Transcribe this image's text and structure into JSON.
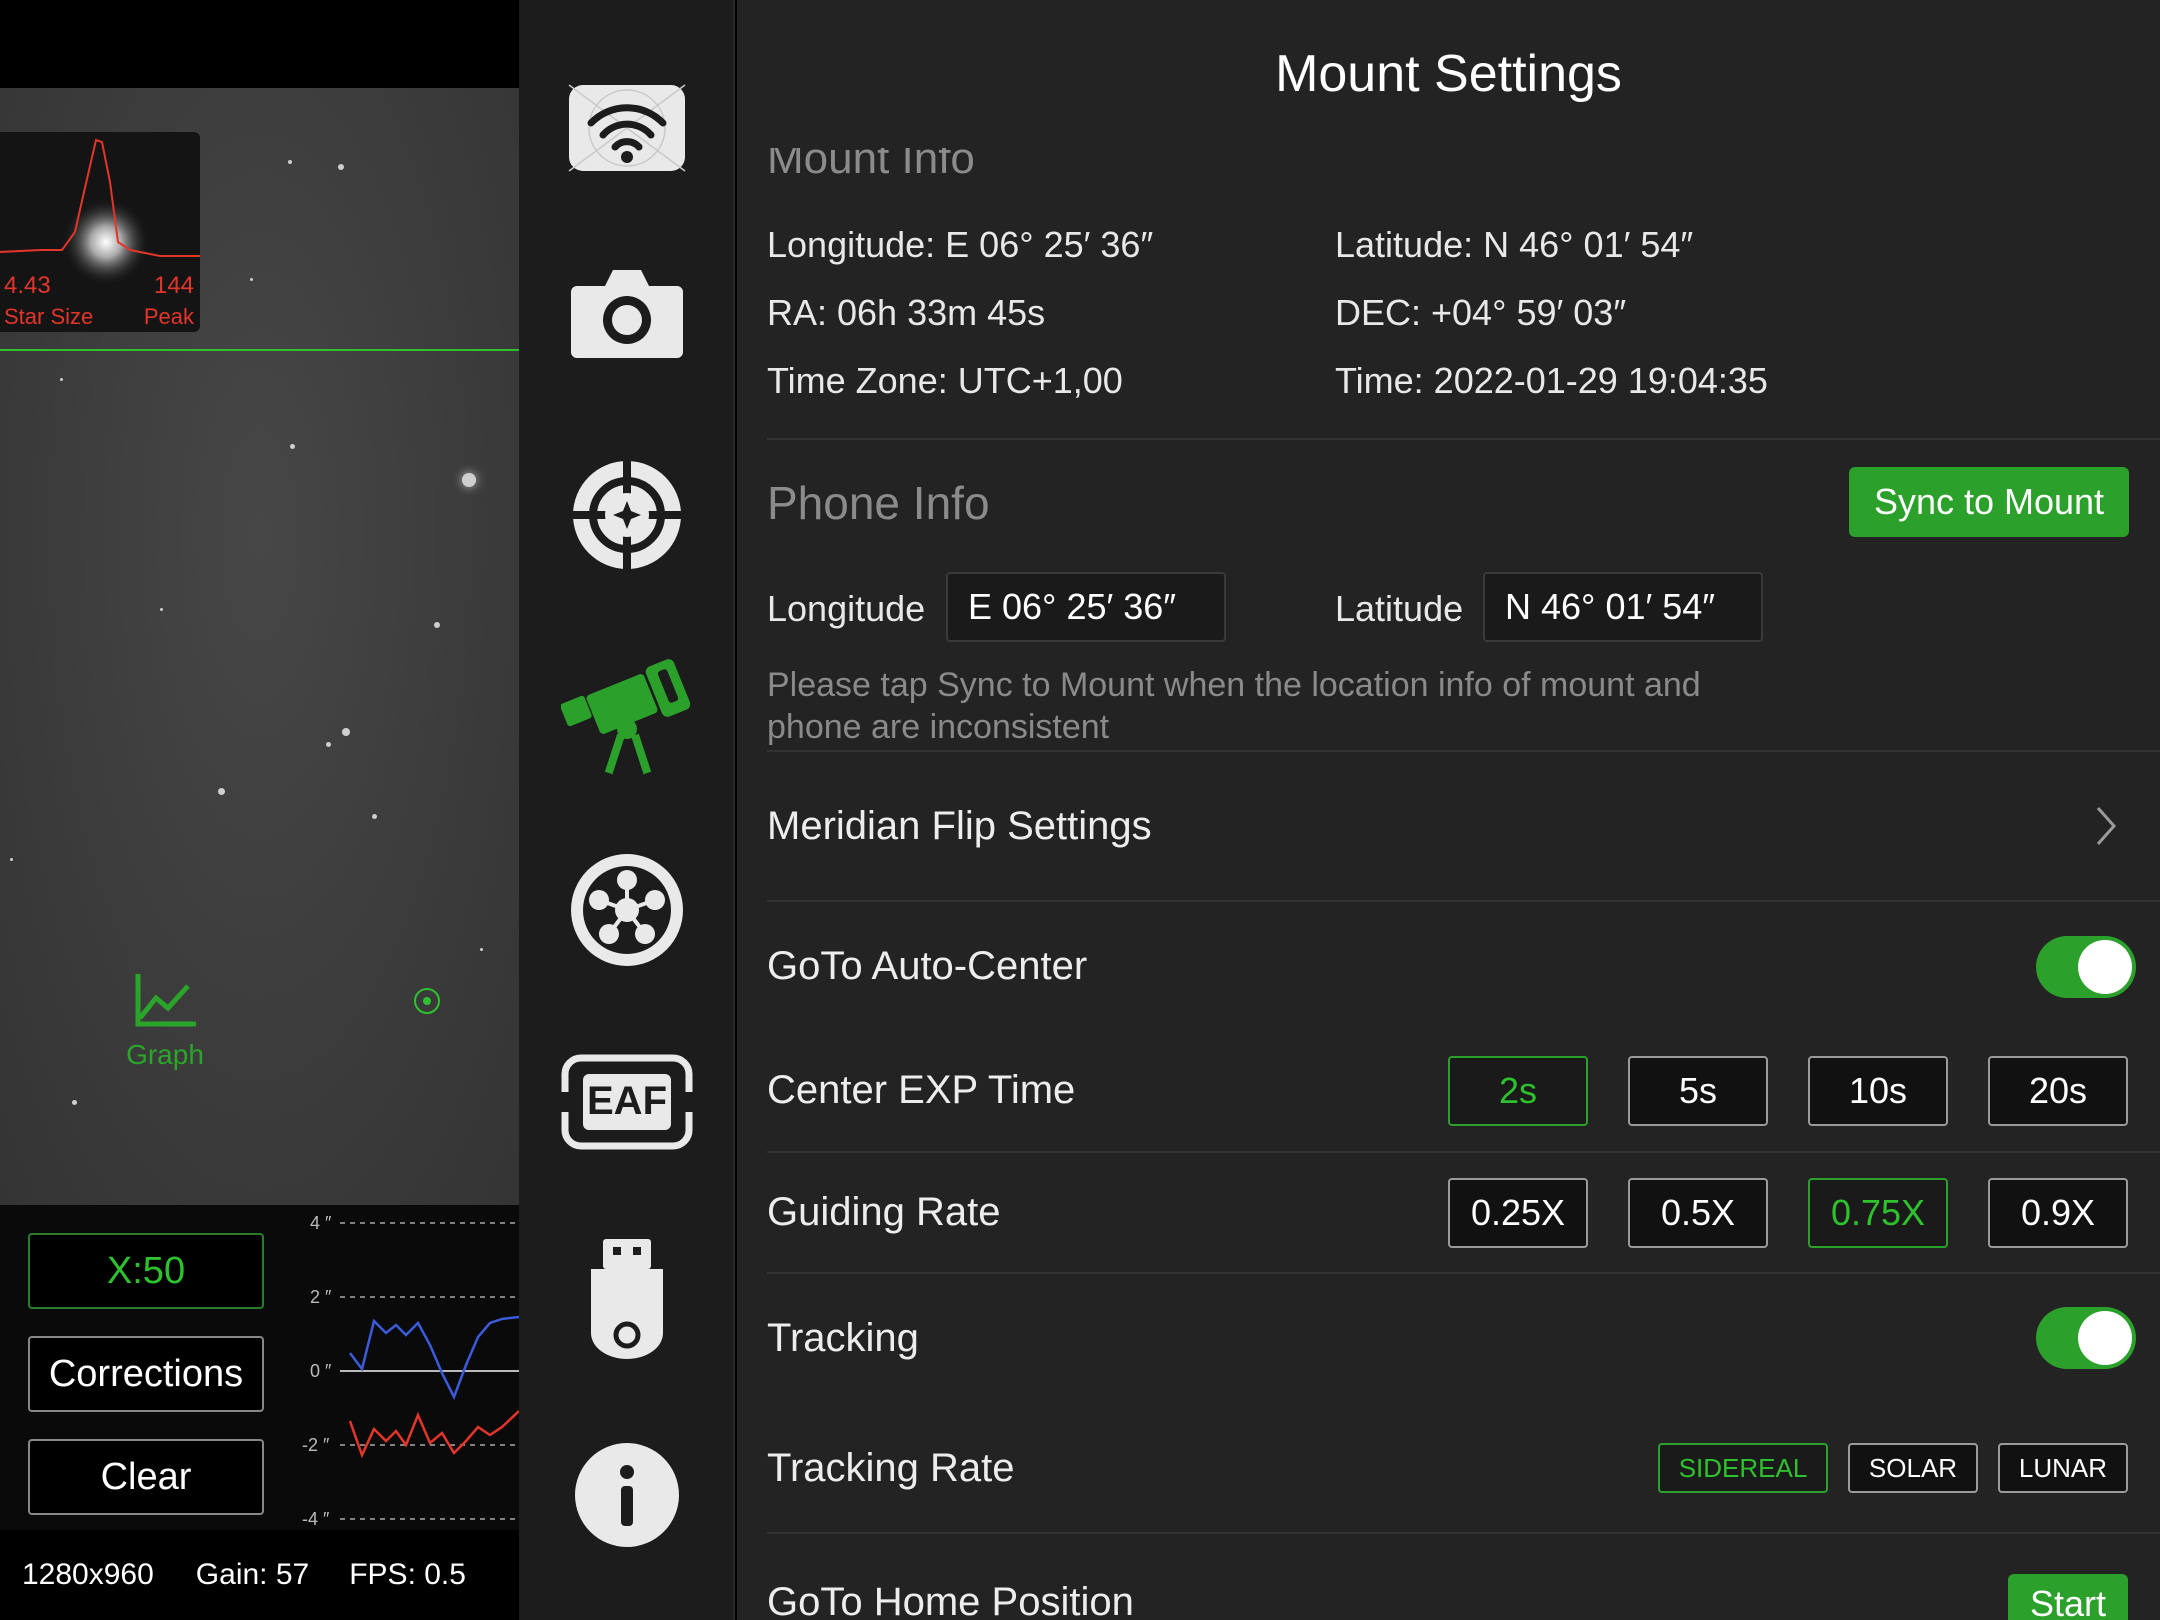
{
  "camera": {
    "star_size_value": "4.43",
    "star_size_label": "Star Size",
    "peak_value": "144",
    "peak_label": "Peak",
    "graph_label": "Graph",
    "zoom_label": "X:50",
    "corrections_label": "Corrections",
    "clear_label": "Clear",
    "resolution": "1280x960",
    "gain": "Gain: 57",
    "fps": "FPS: 0.5",
    "graph_ticks": [
      "4 ″",
      "2 ″",
      "0 ″",
      "-2 ″",
      "-4 ″"
    ],
    "accent_color": "#2dc22d",
    "ra_color": "#3b5bdb",
    "dec_color": "#e4352a"
  },
  "rail": {
    "items": [
      {
        "icon": "wifi-icon",
        "active": false
      },
      {
        "icon": "camera-icon",
        "active": false
      },
      {
        "icon": "crosshair-icon",
        "active": false
      },
      {
        "icon": "telescope-icon",
        "active": true
      },
      {
        "icon": "filter-wheel-icon",
        "active": false
      },
      {
        "icon": "eaf-icon",
        "active": false,
        "text": "EAF"
      },
      {
        "icon": "usb-drive-icon",
        "active": false
      },
      {
        "icon": "info-icon",
        "active": false
      }
    ]
  },
  "panel": {
    "title": "Mount Settings",
    "mount_info": {
      "heading": "Mount Info",
      "longitude": "Longitude: E 06° 25′ 36″",
      "latitude": "Latitude: N 46° 01′ 54″",
      "ra": "RA: 06h 33m 45s",
      "dec": "DEC: +04° 59′ 03″",
      "timezone": "Time Zone: UTC+1,00",
      "time": "Time: 2022-01-29 19:04:35"
    },
    "phone_info": {
      "heading": "Phone Info",
      "sync_label": "Sync to Mount",
      "longitude_label": "Longitude",
      "longitude_value": "E 06° 25′ 36″",
      "latitude_label": "Latitude",
      "latitude_value": "N 46° 01′ 54″",
      "hint": "Please tap Sync to Mount when the location info of mount and phone are inconsistent"
    },
    "meridian_flip": "Meridian Flip Settings",
    "goto_auto_center": {
      "label": "GoTo Auto-Center",
      "on": true
    },
    "center_exp": {
      "label": "Center EXP Time",
      "options": [
        "2s",
        "5s",
        "10s",
        "20s"
      ],
      "selected": "2s"
    },
    "guiding_rate": {
      "label": "Guiding Rate",
      "options": [
        "0.25X",
        "0.5X",
        "0.75X",
        "0.9X"
      ],
      "selected": "0.75X"
    },
    "tracking": {
      "label": "Tracking",
      "on": true
    },
    "tracking_rate": {
      "label": "Tracking Rate",
      "options": [
        "SIDEREAL",
        "SOLAR",
        "LUNAR"
      ],
      "selected": "SIDEREAL"
    },
    "goto_home": {
      "label": "GoTo Home Position",
      "button": "Start"
    },
    "accent_color": "#2ba02b"
  }
}
